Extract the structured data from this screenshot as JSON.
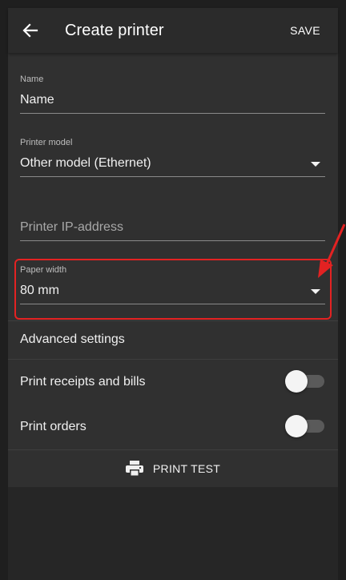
{
  "appbar": {
    "title": "Create printer",
    "save_label": "SAVE",
    "back_icon": "arrow-back-icon"
  },
  "form": {
    "name": {
      "label": "Name",
      "value": "Name"
    },
    "printer_model": {
      "label": "Printer model",
      "value": "Other model (Ethernet)"
    },
    "printer_ip": {
      "placeholder": "Printer IP-address"
    },
    "paper_width": {
      "label": "Paper width",
      "value": "80 mm"
    }
  },
  "sections": {
    "advanced_settings": "Advanced settings",
    "print_receipts": {
      "label": "Print receipts and bills",
      "enabled": false
    },
    "print_orders": {
      "label": "Print orders",
      "enabled": false
    }
  },
  "print_test": {
    "label": "PRINT TEST",
    "icon": "printer-icon"
  },
  "annotation": {
    "color": "#e32222",
    "target": "paper-width-field"
  }
}
